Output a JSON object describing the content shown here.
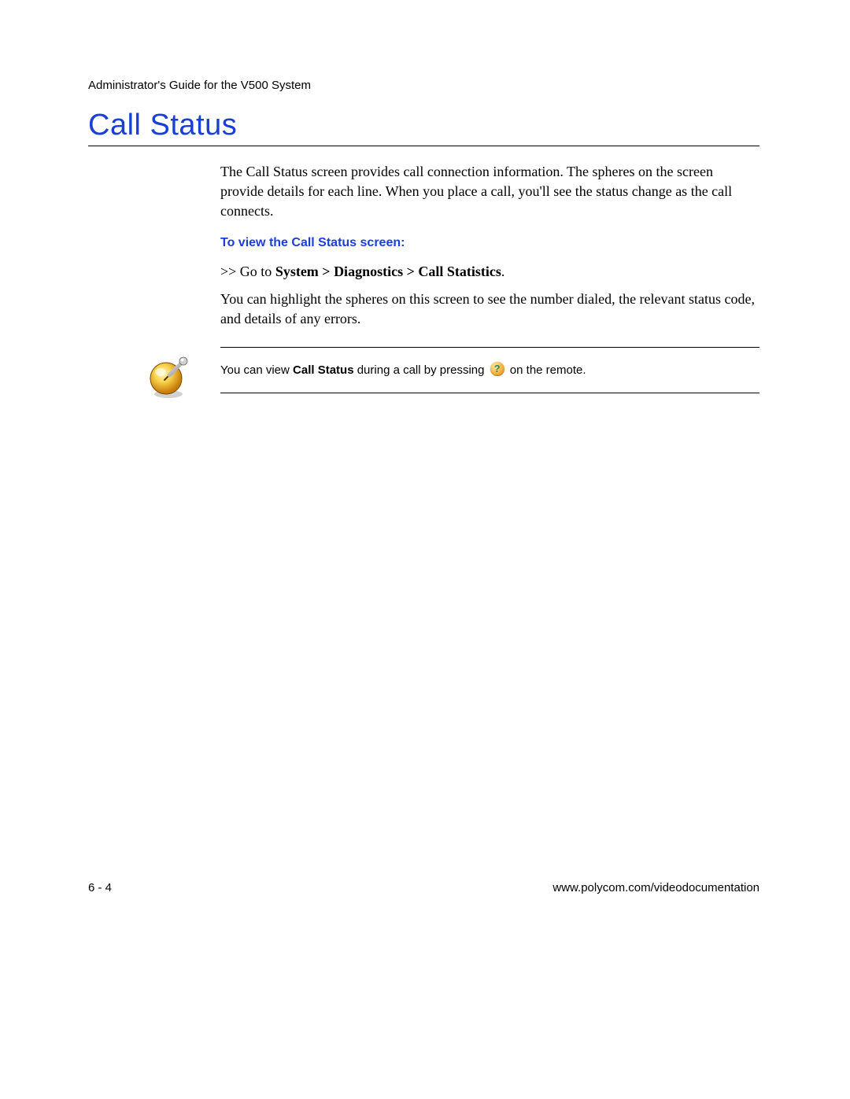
{
  "header": {
    "running": "Administrator's Guide for the V500 System"
  },
  "section": {
    "title": "Call Status",
    "intro": "The Call Status screen provides call connection information. The spheres on the screen provide details for each line. When you place a call, you'll see the status change as the call connects.",
    "procedure_heading": "To view the Call Status screen:",
    "step_prefix": ">> Go to ",
    "step_bold": "System > Diagnostics > Call Statistics",
    "step_suffix": ".",
    "detail": "You can highlight the spheres on this screen to see the number dialed, the relevant status code, and details of any errors."
  },
  "note": {
    "prefix": "You can view ",
    "bold": "Call Status",
    "mid": " during a call by pressing ",
    "suffix": " on the remote."
  },
  "footer": {
    "page": "6 - 4",
    "url": "www.polycom.com/videodocumentation"
  }
}
